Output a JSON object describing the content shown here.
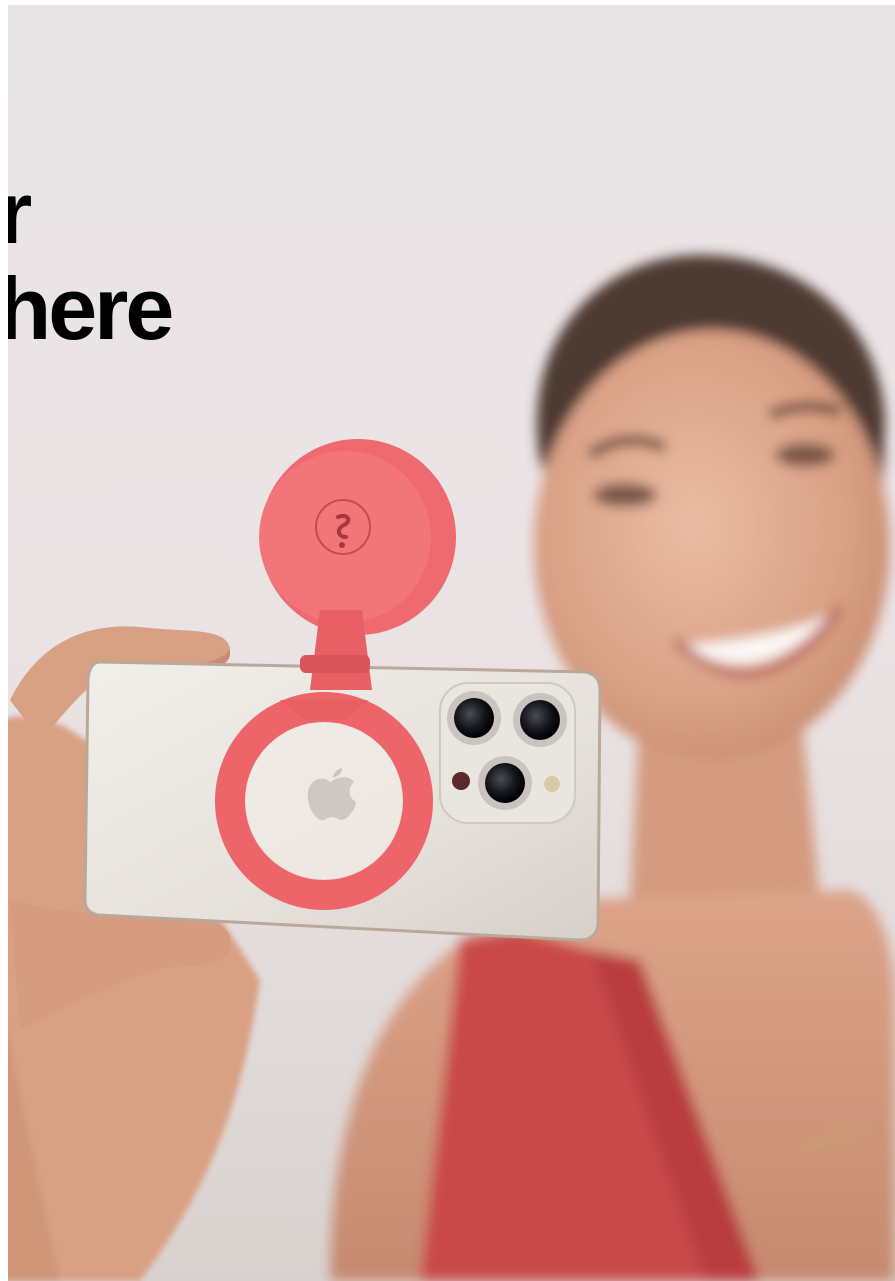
{
  "headline": {
    "line1": "er",
    "line2": "where"
  },
  "colors": {
    "accent_coral": "#f06b6f",
    "dress": "#c9484a",
    "phone_body": "#e7e2dc",
    "skin": "#e2b195",
    "hair": "#4a3a32",
    "text": "#000000"
  },
  "icons": [
    "apple-logo-icon",
    "brand-logo-icon"
  ]
}
